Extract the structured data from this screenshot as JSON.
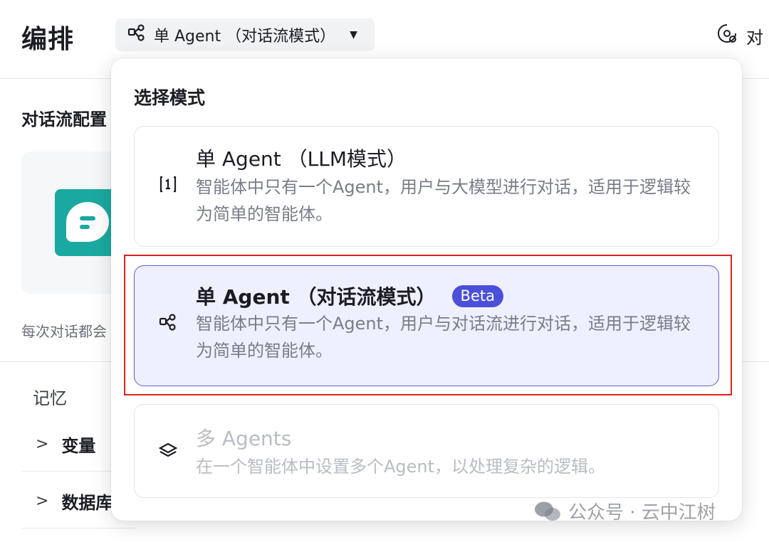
{
  "header": {
    "title": "编排",
    "mode_switch_label": "单 Agent （对话流模式）",
    "right_button_label": "对"
  },
  "background": {
    "section_title": "对话流配置",
    "hint_text": "每次对话都会",
    "memory_label": "记忆",
    "rows": [
      {
        "label": "变量"
      },
      {
        "label": "数据库"
      }
    ]
  },
  "dropdown": {
    "heading": "选择模式",
    "options": [
      {
        "title": "单 Agent （LLM模式）",
        "description": "智能体中只有一个Agent，用户与大模型进行对话，适用于逻辑较为简单的智能体。",
        "icon": "llm-mode-icon",
        "state": "default"
      },
      {
        "title": "单 Agent （对话流模式）",
        "badge": "Beta",
        "description": "智能体中只有一个Agent，用户与对话流进行对话，适用于逻辑较为简单的智能体。",
        "icon": "workflow-icon",
        "state": "selected"
      },
      {
        "title": "多 Agents",
        "description": "在一个智能体中设置多个Agent，以处理复杂的逻辑。",
        "icon": "layers-icon",
        "state": "disabled"
      }
    ]
  },
  "watermark": {
    "text": "公众号 · 云中江树"
  },
  "colors": {
    "accent": "#4b4fd9",
    "selected_bg": "#eff0ff",
    "highlight": "#e0201f",
    "flow_icon_bg": "#1aa9a0"
  }
}
